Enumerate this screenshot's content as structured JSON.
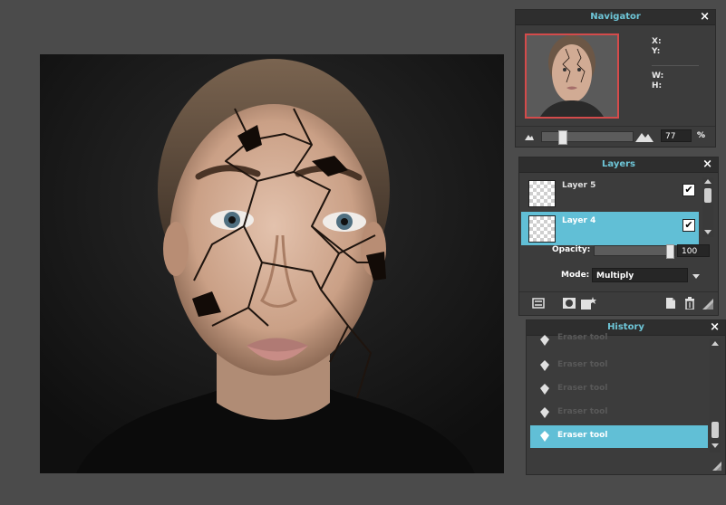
{
  "navigator": {
    "title": "Navigator",
    "close": "×",
    "x_label": "X:",
    "y_label": "Y:",
    "w_label": "W:",
    "h_label": "H:",
    "zoom_value": "77",
    "zoom_unit": "%",
    "zoom_slider_fraction": 0.2
  },
  "layers": {
    "title": "Layers",
    "close": "×",
    "items": [
      {
        "name": "Layer 5",
        "visible": "✔",
        "selected": false
      },
      {
        "name": "Layer 4",
        "visible": "✔",
        "selected": true
      }
    ],
    "opacity_label": "Opacity:",
    "opacity_value": "100",
    "opacity_fraction": 1.0,
    "mode_label": "Mode:",
    "mode_value": "Multiply"
  },
  "history": {
    "title": "History",
    "close": "×",
    "items": [
      {
        "label": "Eraser tool",
        "selected": false
      },
      {
        "label": "Eraser tool",
        "selected": false
      },
      {
        "label": "Eraser tool",
        "selected": false
      },
      {
        "label": "Eraser tool",
        "selected": false
      },
      {
        "label": "Eraser tool",
        "selected": true
      }
    ]
  },
  "colors": {
    "accent": "#61bfd6",
    "panel_title": "#6ec6d8",
    "nav_frame": "#d34b4b",
    "workspace": "#4b4b4b"
  }
}
